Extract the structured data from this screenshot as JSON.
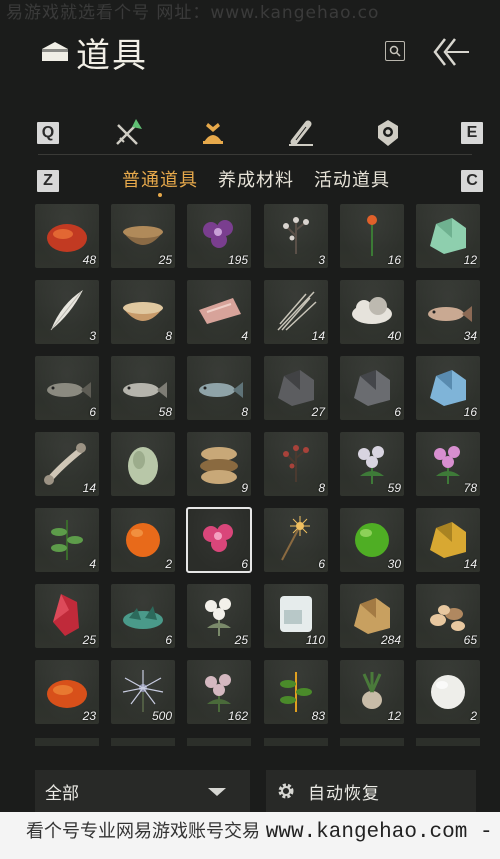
{
  "watermark_top": "易游戏就选看个号   网址：www.kangehao.co",
  "header": {
    "title": "道具",
    "search_icon": "search-icon",
    "back_icon": "back-arrow-icon"
  },
  "category_tabs": {
    "left_key": "Q",
    "right_key": "E",
    "items": [
      {
        "name": "weapons-tab",
        "icon": "crossed-swords-icon",
        "active": false
      },
      {
        "name": "items-tab",
        "icon": "pouch-icon",
        "active": true
      },
      {
        "name": "scrolls-tab",
        "icon": "scroll-icon",
        "active": false
      },
      {
        "name": "tokens-tab",
        "icon": "token-icon",
        "active": false
      }
    ]
  },
  "sub_tabs": {
    "left_key": "Z",
    "right_key": "C",
    "items": [
      {
        "label": "普通道具",
        "active": true
      },
      {
        "label": "养成材料",
        "active": false
      },
      {
        "label": "活动道具",
        "active": false
      }
    ]
  },
  "items": [
    {
      "icon": "red-gem-icon",
      "qty": "48"
    },
    {
      "icon": "mortar-bowl-icon",
      "qty": "25"
    },
    {
      "icon": "purple-flower-icon",
      "qty": "195"
    },
    {
      "icon": "white-blossom-icon",
      "qty": "3"
    },
    {
      "icon": "orange-flower-icon",
      "qty": "16"
    },
    {
      "icon": "jade-stone-icon",
      "qty": "12"
    },
    {
      "icon": "feather-icon",
      "qty": "3"
    },
    {
      "icon": "bowl-icon",
      "qty": "8"
    },
    {
      "icon": "meat-icon",
      "qty": "4"
    },
    {
      "icon": "grass-icon",
      "qty": "14"
    },
    {
      "icon": "fleece-icon",
      "qty": "40"
    },
    {
      "icon": "pufferfish-icon",
      "qty": "34"
    },
    {
      "icon": "grey-fish-icon",
      "qty": "6"
    },
    {
      "icon": "silver-fish-icon",
      "qty": "58"
    },
    {
      "icon": "blue-fish-icon",
      "qty": "8"
    },
    {
      "icon": "dark-ore-icon",
      "qty": "27"
    },
    {
      "icon": "black-ore-icon",
      "qty": "6"
    },
    {
      "icon": "blue-ore-icon",
      "qty": "16"
    },
    {
      "icon": "bone-icon",
      "qty": "14"
    },
    {
      "icon": "melon-icon",
      "qty": ""
    },
    {
      "icon": "sack-icon",
      "qty": "9"
    },
    {
      "icon": "red-berry-plant-icon",
      "qty": "8"
    },
    {
      "icon": "aster-flower-icon",
      "qty": "59"
    },
    {
      "icon": "pink-aster-icon",
      "qty": "78"
    },
    {
      "icon": "herb-icon",
      "qty": "4"
    },
    {
      "icon": "persimmon-icon",
      "qty": "2"
    },
    {
      "icon": "pink-flower-icon",
      "qty": "6",
      "selected": true
    },
    {
      "icon": "sparkler-icon",
      "qty": "6"
    },
    {
      "icon": "green-orb-icon",
      "qty": "30"
    },
    {
      "icon": "gold-nugget-icon",
      "qty": "14"
    },
    {
      "icon": "red-crystal-icon",
      "qty": "25"
    },
    {
      "icon": "green-shards-icon",
      "qty": "6"
    },
    {
      "icon": "white-bouquet-icon",
      "qty": "25"
    },
    {
      "icon": "ice-block-icon",
      "qty": "110"
    },
    {
      "icon": "bark-icon",
      "qty": "284"
    },
    {
      "icon": "pebbles-icon",
      "qty": "65"
    },
    {
      "icon": "amber-stone-icon",
      "qty": "23"
    },
    {
      "icon": "silver-spider-flower-icon",
      "qty": "500"
    },
    {
      "icon": "rose-bush-icon",
      "qty": "162"
    },
    {
      "icon": "fruit-branch-icon",
      "qty": "83"
    },
    {
      "icon": "root-plant-icon",
      "qty": "12"
    },
    {
      "icon": "snowball-icon",
      "qty": "2"
    }
  ],
  "bottom": {
    "filter_label": "全部",
    "auto_label": "自动恢复"
  },
  "watermark_bottom": {
    "text": "看个号专业网易游戏账号交易 ",
    "url": "www.kangehao.com -"
  },
  "colors": {
    "accent": "#e7a94b",
    "background": "#1b1c1b",
    "cell": "#30332e"
  }
}
